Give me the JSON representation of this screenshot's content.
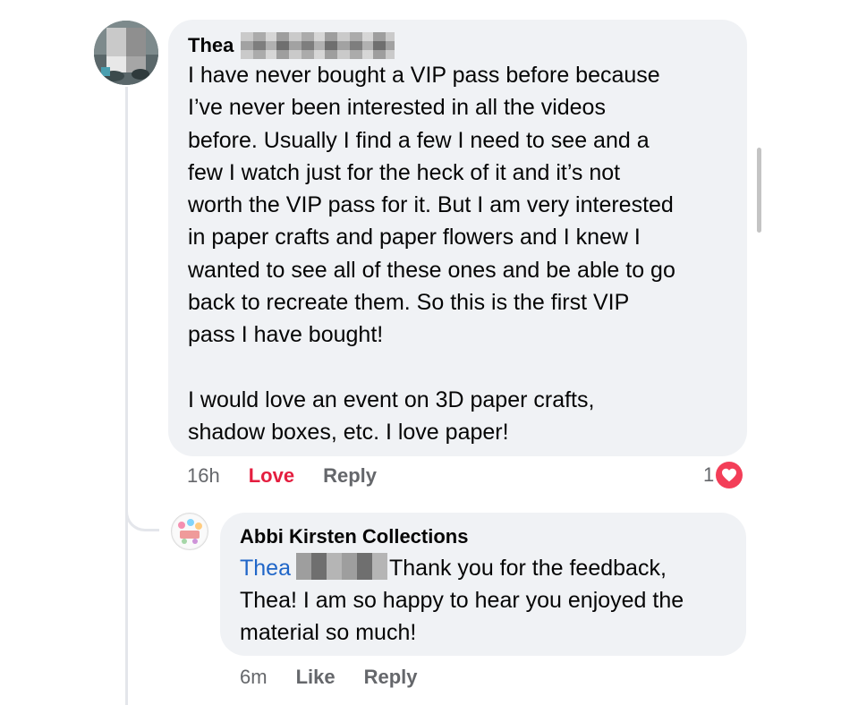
{
  "comment": {
    "author": "Thea",
    "body": "I have never bought a VIP pass before because\nI’ve never been interested in all the videos\nbefore. Usually I find a few I need to see and a\nfew I watch just for the heck of it and it’s not\nworth the VIP pass for it. But I am very interested\nin paper crafts and paper flowers and I knew I\nwanted to see all of these ones and be able to go\nback to recreate them. So this is the first VIP\npass I have bought!\n\nI would love an event on 3D paper crafts,\nshadow boxes, etc. I love paper!",
    "time": "16h",
    "love_label": "Love",
    "reply_label": "Reply",
    "reaction_count": "1"
  },
  "reply": {
    "author": "Abbi Kirsten Collections",
    "mention": "Thea",
    "body_line1": "Thank you for the feedback,",
    "body_rest": "Thea! I am so happy to hear you enjoyed the material so much!",
    "time": "6m",
    "like_label": "Like",
    "reply_label": "Reply"
  },
  "colors": {
    "bubble": "#f0f2f5",
    "love": "#e41e3f",
    "mention": "#2066c8",
    "heart": "#f33e58"
  }
}
